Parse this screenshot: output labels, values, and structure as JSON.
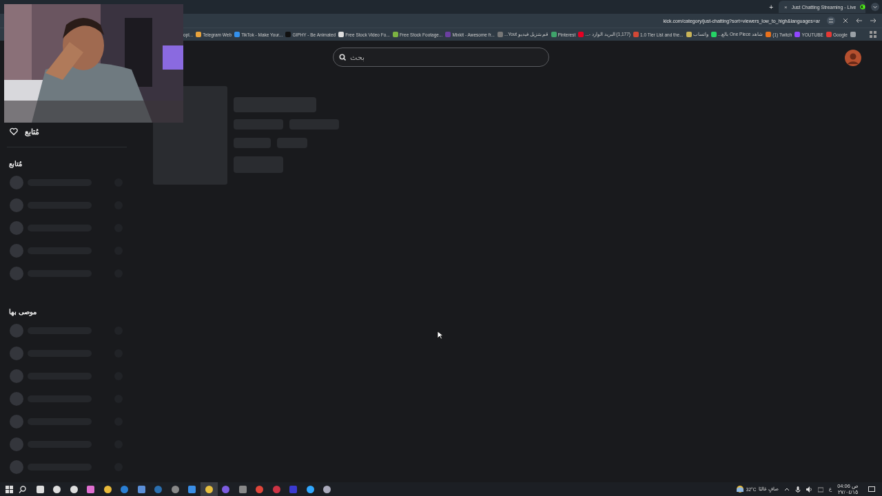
{
  "browser": {
    "tabs": [
      {
        "title": "Just Chatting Streaming - Live",
        "selected": true
      }
    ],
    "new_tab": "+",
    "tab_close": "×",
    "address": "kick.com/category/just-chatting?sort=viewers_low_to_high&languages=ar",
    "bookmarks": [
      {
        "label": "Google",
        "color": "#9aa0a6"
      },
      {
        "label": "YOUTUBE",
        "color": "#e53935"
      },
      {
        "label": "(1) Twitch",
        "color": "#9146ff"
      },
      {
        "label": "شاهد One Piece بالع...",
        "color": "#e8711c"
      },
      {
        "label": "واتساب",
        "color": "#25d366"
      },
      {
        "label": "1.0 Tier List and the...",
        "color": "#c9b458"
      },
      {
        "label": "(1,177) البريد الوارد -...",
        "color": "#d14836"
      },
      {
        "label": "Pinterest",
        "color": "#e60023"
      },
      {
        "label": "قم بتنزيل فيديو Yout...",
        "color": "#3fa36b"
      },
      {
        "label": "Mixkit - Awesome fr...",
        "color": "#777777"
      },
      {
        "label": "Free Stock Footage...",
        "color": "#6b3fa0"
      },
      {
        "label": "Free Stock Video Fo...",
        "color": "#7cb342"
      },
      {
        "label": "GIPHY - Be Animated",
        "color": "#dddddd"
      },
      {
        "label": "TikTok - Make Your...",
        "color": "#111111"
      },
      {
        "label": "Telegram Web",
        "color": "#3390ec"
      },
      {
        "label": "opl...",
        "color": "#e8a33c"
      }
    ]
  },
  "header": {
    "search": {
      "placeholder": "بحث"
    }
  },
  "sidebar": {
    "following_link": "مُتابع",
    "sections": [
      {
        "title": "مُتابع"
      },
      {
        "title": "موصى بها"
      }
    ]
  },
  "taskbar": {
    "apps": [
      {
        "selected": false
      },
      {
        "selected": false
      },
      {
        "selected": false
      },
      {
        "selected": false
      },
      {
        "selected": false
      },
      {
        "selected": false
      },
      {
        "selected": false
      },
      {
        "selected": false
      },
      {
        "selected": false
      },
      {
        "selected": false
      },
      {
        "selected": true
      },
      {
        "selected": false
      },
      {
        "selected": false
      },
      {
        "selected": false
      },
      {
        "selected": false
      },
      {
        "selected": false
      },
      {
        "selected": false
      },
      {
        "selected": false
      }
    ],
    "weather": {
      "temperature": "32°C",
      "condition": "صافٍ غالبًا"
    },
    "language": "ع",
    "time": "04:06",
    "period": "ص",
    "date": "٢٧/٠٤/١٥"
  }
}
